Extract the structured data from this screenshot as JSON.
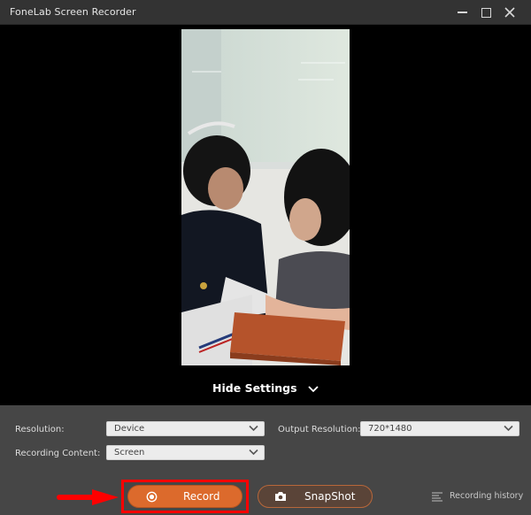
{
  "window": {
    "title": "FoneLab Screen Recorder",
    "controls": [
      "minimize-icon",
      "maximize-icon",
      "close-icon"
    ]
  },
  "preview": {
    "content": "phone screen mirror showing two people at a desk",
    "toggle_label": "Hide Settings",
    "toggle_icon": "chevron-down-icon"
  },
  "settings": {
    "resolution": {
      "label": "Resolution:",
      "value": "Device"
    },
    "output_resolution": {
      "label": "Output Resolution:",
      "value": "720*1480"
    },
    "recording_content": {
      "label": "Recording Content:",
      "value": "Screen"
    }
  },
  "actions": {
    "record": {
      "label": "Record",
      "icon": "record-icon"
    },
    "snapshot": {
      "label": "SnapShot",
      "icon": "camera-icon"
    },
    "history": {
      "label": "Recording history",
      "icon": "list-icon"
    }
  },
  "annotation": {
    "highlight_color": "#ff0000",
    "target": "record-button",
    "arrow_icon": "arrow-right-icon"
  },
  "colors": {
    "accent": "#dc6a2c",
    "titlebar": "#333333",
    "panel": "#464646"
  }
}
